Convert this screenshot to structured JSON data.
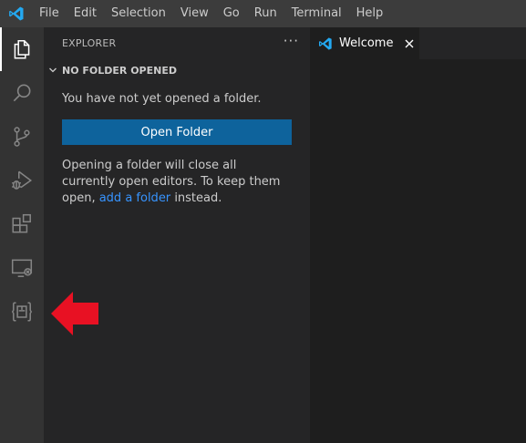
{
  "menu": {
    "items": [
      "File",
      "Edit",
      "Selection",
      "View",
      "Go",
      "Run",
      "Terminal",
      "Help"
    ]
  },
  "activity_bar": {
    "items": [
      "explorer-icon",
      "search-icon",
      "source-control-icon",
      "run-debug-icon",
      "extensions-icon",
      "remote-explorer-icon",
      "extension-braces-icon"
    ],
    "active": "explorer-icon"
  },
  "sidebar": {
    "title": "EXPLORER",
    "more": "···",
    "section": {
      "title": "NO FOLDER OPENED"
    },
    "empty_message": "You have not yet opened a folder.",
    "open_folder_label": "Open Folder",
    "hint_before": "Opening a folder will close all currently open editors. To keep them open,",
    "hint_link": "add a folder",
    "hint_after": "instead."
  },
  "editor": {
    "tab_label": "Welcome"
  },
  "colors": {
    "titlebar": "#3c3c3c",
    "activity_bar": "#333333",
    "sidebar": "#252526",
    "editor": "#1e1e1e",
    "button": "#0e639c",
    "link": "#3794ff",
    "annotation_arrow": "#e81123",
    "vscode_blue": "#23a9f2"
  }
}
